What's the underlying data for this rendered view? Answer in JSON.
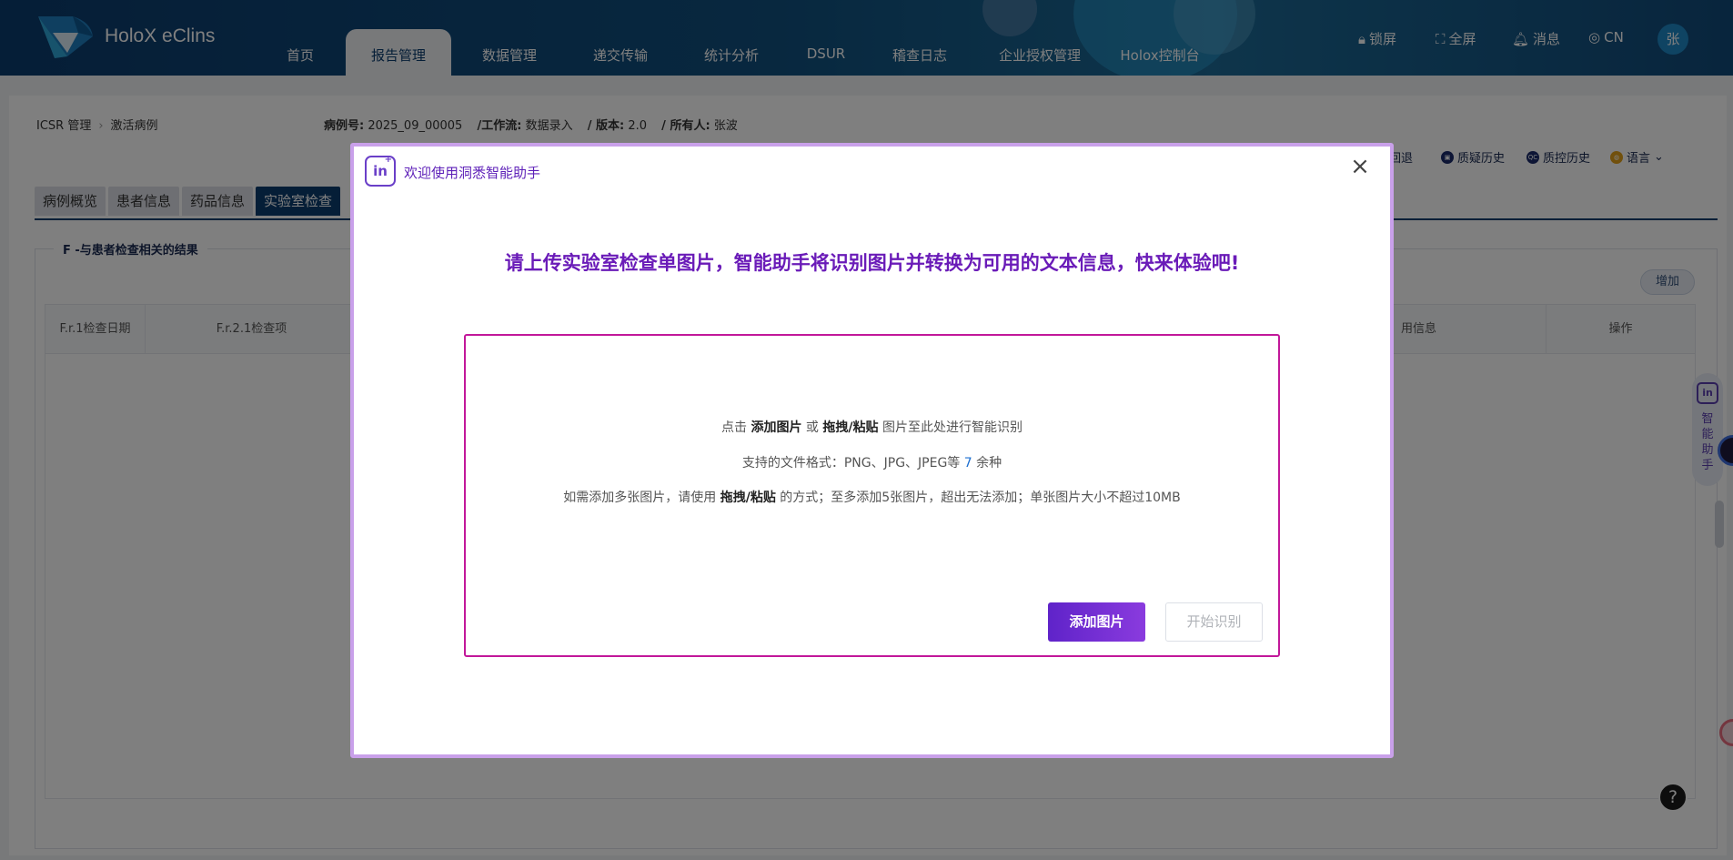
{
  "header": {
    "brand": "HoloX eClins",
    "nav": [
      "首页",
      "报告管理",
      "数据管理",
      "递交传输",
      "统计分析",
      "DSUR",
      "稽查日志",
      "企业授权管理",
      "Holox控制台"
    ],
    "active_nav": "报告管理",
    "tools": {
      "lock": "锁屏",
      "fullscreen": "全屏",
      "messages": "消息",
      "lang": "CN"
    },
    "avatar": "张"
  },
  "breadcrumb": {
    "root": "ICSR 管理",
    "current": "激活病例"
  },
  "case_info": {
    "case_no_label": "病例号:",
    "case_no": "2025_09_00005",
    "workflow_label": "/工作流:",
    "workflow": "数据录入",
    "version_label": "/ 版本:",
    "version": "2.0",
    "owner_label": "/ 所有人:",
    "owner": "张波"
  },
  "right_tools": {
    "rollback": "回退",
    "query_history": "质疑历史",
    "qc_history": "质控历史",
    "language": "语言"
  },
  "tabs": [
    "病例概览",
    "患者信息",
    "药品信息",
    "实验室检查"
  ],
  "section": {
    "title": "F -与患者检查相关的结果",
    "add_button": "增加",
    "columns": [
      "F.r.1检查日期",
      "F.r.2.1检查项",
      "用信息",
      "操作"
    ]
  },
  "side_assistant": {
    "label": "智能助手"
  },
  "help": "?",
  "modal": {
    "title": "欢迎使用洞悉智能助手",
    "logo_text": "in",
    "headline": "请上传实验室检查单图片，智能助手将识别图片并转换为可用的文本信息，快来体验吧!",
    "line1": {
      "prefix": "点击 ",
      "add": "添加图片",
      "or": " 或 ",
      "drag": "拖拽/粘贴",
      "suffix": " 图片至此处进行智能识别"
    },
    "line2": {
      "prefix": "支持的文件格式：PNG、JPG、JPEG等 ",
      "count": "7",
      "suffix": " 余种"
    },
    "line3": {
      "prefix": "如需添加多张图片，请使用 ",
      "drag": "拖拽/粘贴",
      "suffix": " 的方式；至多添加5张图片，超出无法添加；单张图片大小不超过10MB"
    },
    "add_button": "添加图片",
    "start_button": "开始识别"
  },
  "colors": {
    "header_bg": "#0b3c6e",
    "accent_purple": "#6a1bb8",
    "dropzone_border": "#c2189a"
  }
}
